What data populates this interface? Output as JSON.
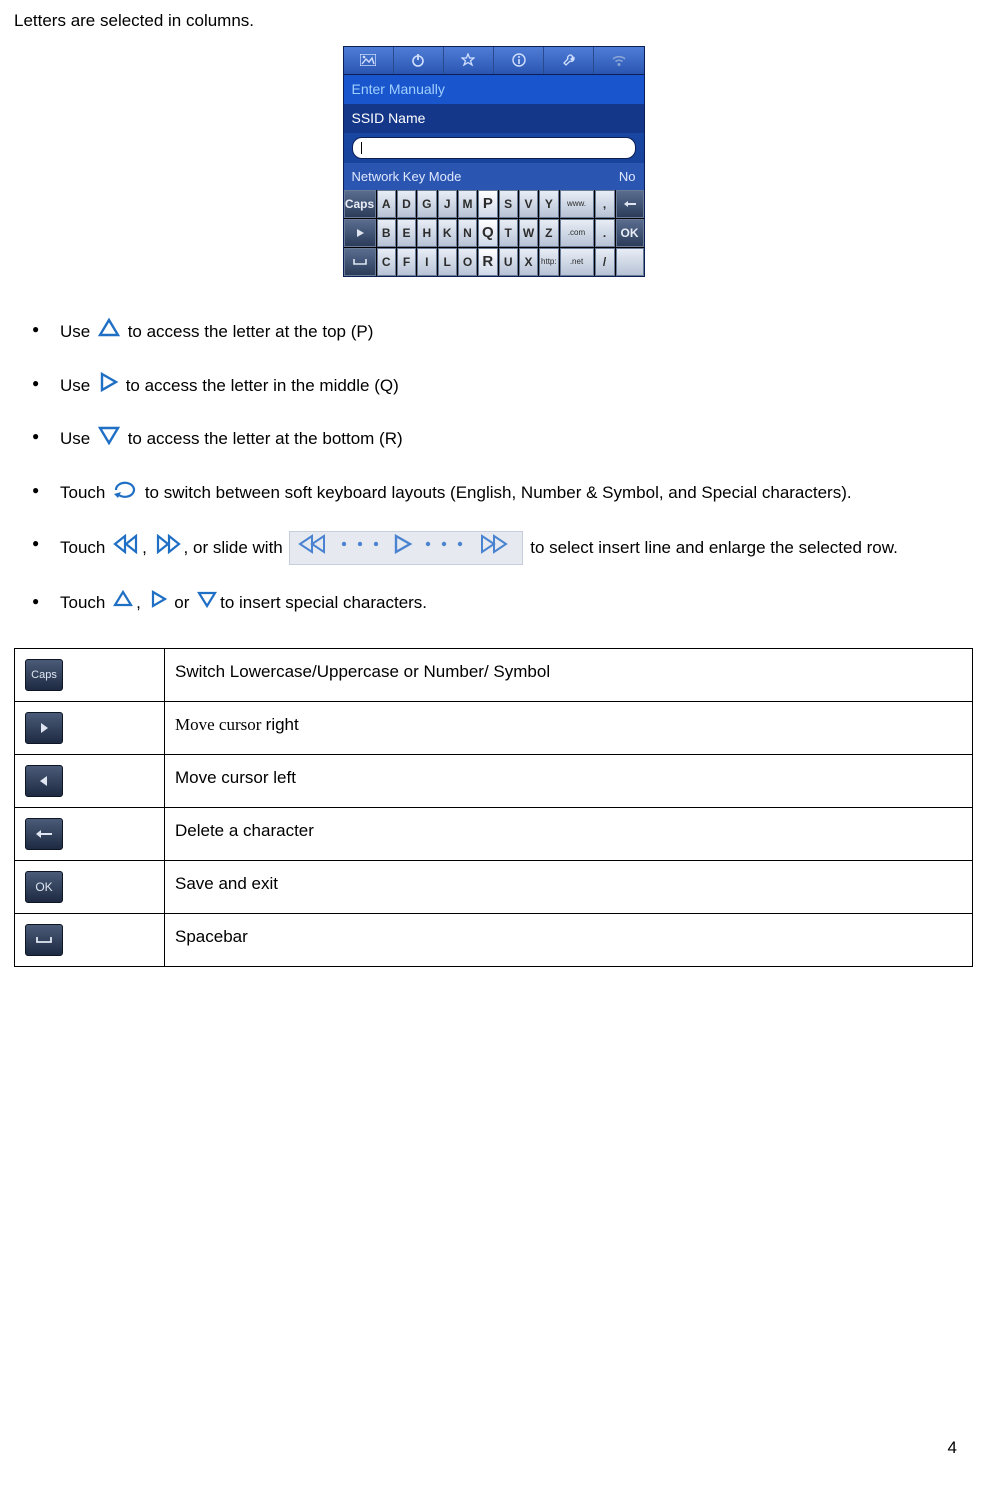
{
  "intro": "Letters are selected in columns.",
  "screenshot": {
    "header_enter": "Enter Manually",
    "ssid_label": "SSID Name",
    "mode_label": "Network Key Mode",
    "mode_value": "No",
    "keyboard_rows": [
      [
        "Caps",
        "A",
        "D",
        "G",
        "J",
        "M",
        "P",
        "S",
        "V",
        "Y",
        "www.",
        ",",
        "←"
      ],
      [
        "▶",
        "B",
        "E",
        "H",
        "K",
        "N",
        "Q",
        "T",
        "W",
        "Z",
        ".com",
        ".",
        "OK"
      ],
      [
        "⎵",
        "C",
        "F",
        "I",
        "L",
        "O",
        "R",
        "U",
        "X",
        "http:",
        ".net",
        "/",
        ""
      ]
    ],
    "focus_column": [
      "P",
      "Q",
      "R"
    ]
  },
  "bullets": {
    "b1": {
      "a": "Use ",
      "b": " to access the letter at the top (P)"
    },
    "b2": {
      "a": "Use ",
      "b": "to access the letter in the middle (Q)"
    },
    "b3": {
      "a": "Use ",
      "b": " to access the letter at the bottom (R)"
    },
    "b4": {
      "a": "Touch ",
      "b": " to switch between soft keyboard layouts (English, Number & Symbol, and Special characters)."
    },
    "b5": {
      "a": "Touch ",
      "b": ", ",
      "c": ", or slide with  ",
      "d": "to select insert line and enlarge the selected row."
    },
    "b6": {
      "a": "Touch ",
      "b": ", ",
      "c": " or ",
      "d": "to insert special characters."
    }
  },
  "table": {
    "r1": {
      "label": "Caps",
      "desc": "Switch Lowercase/Uppercase or Number/ Symbol"
    },
    "r2": {
      "desc_a": "Move cursor ",
      "desc_b": "right"
    },
    "r3": {
      "desc": "Move cursor left"
    },
    "r4": {
      "desc": "Delete a character"
    },
    "r5": {
      "label": "OK",
      "desc": "Save and exit"
    },
    "r6": {
      "desc": "Spacebar"
    }
  },
  "page_number": "4"
}
